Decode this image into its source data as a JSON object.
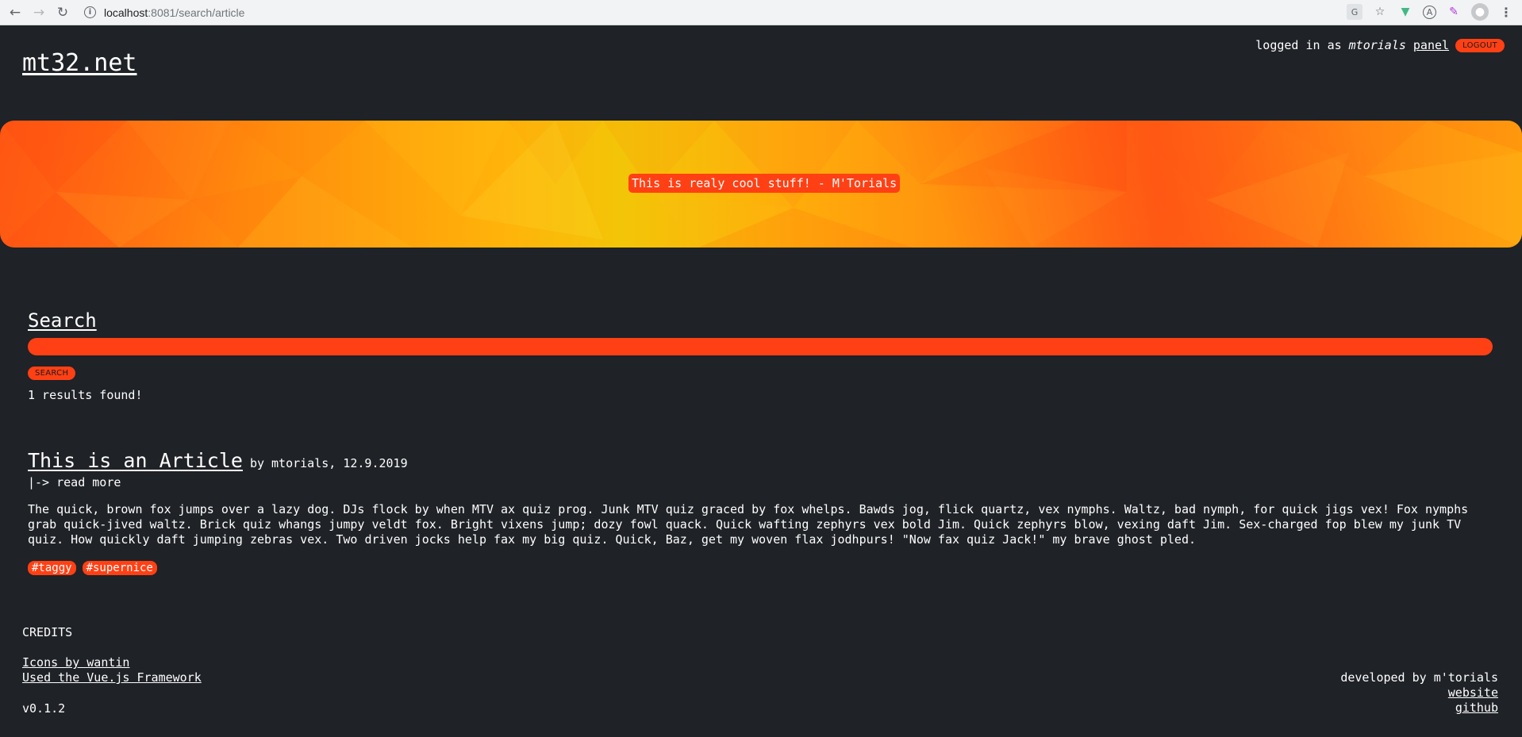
{
  "browser": {
    "url_host": "localhost",
    "url_rest": ":8081/search/article",
    "icons": [
      "back-icon",
      "forward-icon",
      "reload-icon",
      "info-icon",
      "translate-icon",
      "star-icon",
      "vue-devtools-icon",
      "extension-a-icon",
      "extension-eyedropper-icon",
      "profile-icon",
      "menu-icon"
    ]
  },
  "header": {
    "site_title": "mt32.net",
    "logged_in_prefix": "logged in as",
    "username": "mtorials",
    "panel_link": "panel",
    "logout_label": "LOGOUT"
  },
  "banner": {
    "quote": "This is realy cool stuff! - M'Torials"
  },
  "search": {
    "heading": "Search",
    "input_value": "",
    "button_label": "SEARCH",
    "results_text": "1 results found!"
  },
  "article": {
    "title": "This is an Article",
    "meta": "by mtorials, 12.9.2019",
    "read_more": "|-> read more",
    "body": "The quick, brown fox jumps over a lazy dog. DJs flock by when MTV ax quiz prog. Junk MTV quiz graced by fox whelps. Bawds jog, flick quartz, vex nymphs. Waltz, bad nymph, for quick jigs vex! Fox nymphs grab quick-jived waltz. Brick quiz whangs jumpy veldt fox. Bright vixens jump; dozy fowl quack. Quick wafting zephyrs vex bold Jim. Quick zephyrs blow, vexing daft Jim. Sex-charged fop blew my junk TV quiz. How quickly daft jumping zebras vex. Two driven jocks help fax my big quiz. Quick, Baz, get my woven flax jodhpurs! \"Now fax quiz Jack!\" my brave ghost pled.",
    "tags": [
      "#taggy",
      "#supernice"
    ]
  },
  "footer": {
    "credits_heading": "CREDITS",
    "icons_credit": "Icons by wantin",
    "framework_credit": "Used the Vue.js Framework",
    "version": "v0.1.2",
    "developed_by": "developed by m'torials",
    "website_link": "website",
    "github_link": "github"
  },
  "colors": {
    "background": "#1f2227",
    "accent": "#ff4014",
    "banner_orange": "#ff8f0c",
    "banner_yellow": "#f3c508"
  }
}
